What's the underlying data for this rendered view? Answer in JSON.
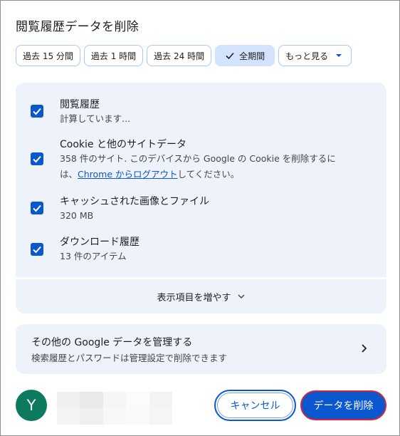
{
  "dialog": {
    "title": "閲覧履歴データを削除"
  },
  "time_range": {
    "chips": [
      {
        "label": "過去 15 分間",
        "selected": false
      },
      {
        "label": "過去 1 時間",
        "selected": false
      },
      {
        "label": "過去 24 時間",
        "selected": false
      },
      {
        "label": "全期間",
        "selected": true
      },
      {
        "label": "もっと見る",
        "selected": false
      }
    ]
  },
  "items": [
    {
      "title": "閲覧履歴",
      "subtitle": "計算しています...",
      "checked": true
    },
    {
      "title": "Cookie と他のサイトデータ",
      "subtitle_line1": "358 件のサイト. このデバイスから Google の Cookie を削除するに",
      "subtitle_line2_prefix": "は、",
      "subtitle_line2_link": "Chrome からログアウト",
      "subtitle_line2_suffix": "してください。",
      "checked": true
    },
    {
      "title": "キャッシュされた画像とファイル",
      "subtitle": "320 MB",
      "checked": true
    },
    {
      "title": "ダウンロード履歴",
      "subtitle": "13 件のアイテム",
      "checked": true
    }
  ],
  "expand": {
    "label": "表示項目を増やす"
  },
  "manage": {
    "title": "その他の Google データを管理する",
    "subtitle": "検索履歴とパスワードは管理設定で削除できます"
  },
  "account": {
    "avatar_letter": "Y"
  },
  "buttons": {
    "cancel": "キャンセル",
    "delete": "データを削除"
  },
  "colors": {
    "accent": "#0b57d0",
    "surface": "#eef3fb",
    "avatar": "#0b7a5e",
    "focus_ring": "#d3263a"
  },
  "icons": {
    "check": "check-icon",
    "caret": "caret-down-icon",
    "chevron": "chevron-down-icon",
    "arrow": "chevron-right-icon"
  }
}
